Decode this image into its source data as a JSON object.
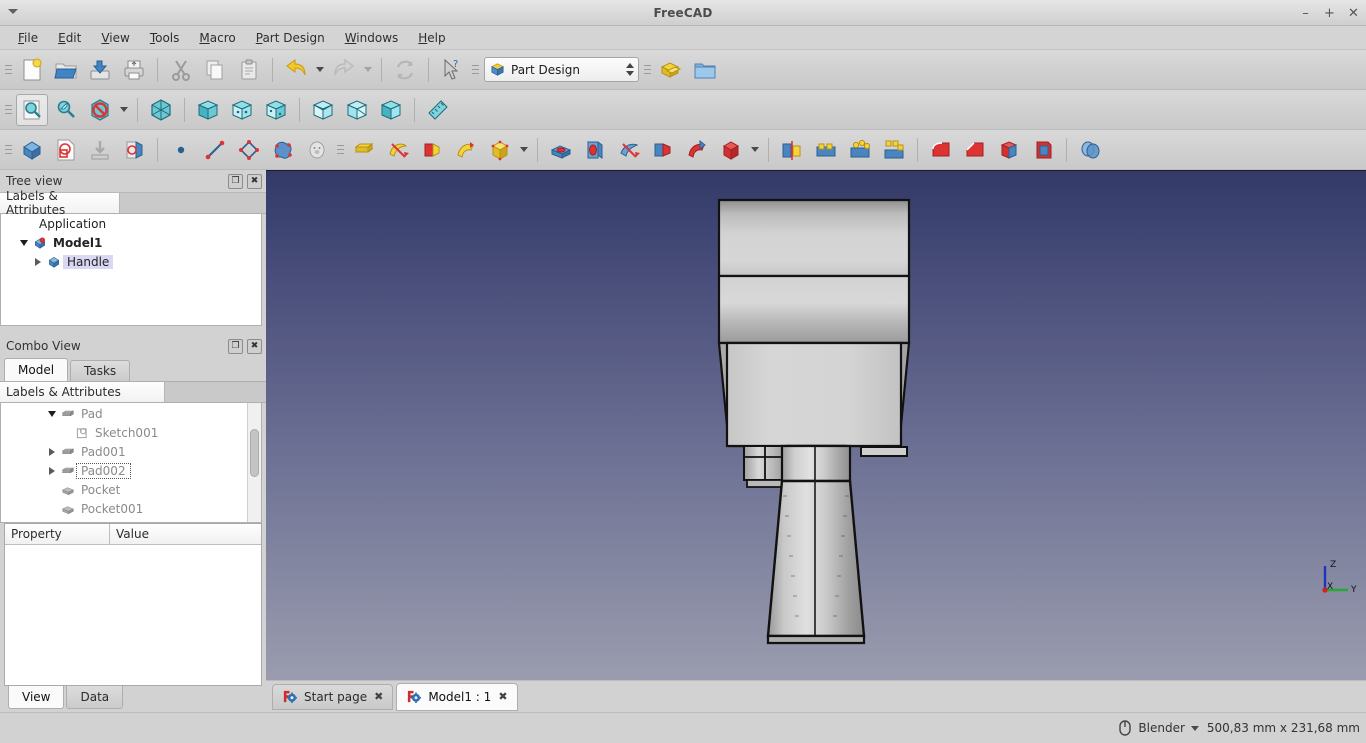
{
  "window": {
    "title": "FreeCAD",
    "minimize": "–",
    "maximize": "+",
    "close": "✕"
  },
  "menubar": {
    "items": [
      {
        "label": "File",
        "accel": "F"
      },
      {
        "label": "Edit",
        "accel": "E"
      },
      {
        "label": "View",
        "accel": "V"
      },
      {
        "label": "Tools",
        "accel": "T"
      },
      {
        "label": "Macro",
        "accel": "M"
      },
      {
        "label": "Part Design",
        "accel": "P"
      },
      {
        "label": "Windows",
        "accel": "W"
      },
      {
        "label": "Help",
        "accel": "H"
      }
    ]
  },
  "toolbars": {
    "file": {
      "icons": [
        "new-document-icon",
        "open-folder-icon",
        "save-icon",
        "print-icon",
        "cut-icon",
        "copy-icon",
        "paste-icon",
        "undo-icon",
        "redo-icon",
        "refresh-icon"
      ]
    },
    "workbench": {
      "whatsthis_icon": "whats-this-icon",
      "selected": "Part Design",
      "options": [
        "Part Design"
      ],
      "macro_icon": "macro-icon",
      "folder_icon": "folder-icon"
    },
    "view": {
      "icons": [
        "fit-all-icon",
        "zoom-box-icon",
        "draw-style-icon",
        "axonometric-icon",
        "front-view-icon",
        "top-view-icon",
        "right-view-icon",
        "rear-view-icon",
        "bottom-view-icon",
        "left-view-icon",
        "measure-icon"
      ]
    },
    "partdesign": {
      "icons": [
        "create-body-icon",
        "create-sketch-icon",
        "attachment-icon",
        "edit-sketch-icon",
        "point-icon",
        "line-icon",
        "datum-plane-icon",
        "shape-binder-icon",
        "clone-icon",
        "pad-icon",
        "revolution-icon",
        "additive-loft-icon",
        "additive-pipe-icon",
        "additive-box-icon",
        "pocket-icon",
        "hole-icon",
        "groove-icon",
        "subtractive-loft-icon",
        "subtractive-pipe-icon",
        "subtractive-box-icon",
        "mirrored-icon",
        "linear-pattern-icon",
        "polar-pattern-icon",
        "multi-transform-icon",
        "fillet-icon",
        "chamfer-icon",
        "draft-icon",
        "thickness-icon",
        "boolean-icon"
      ]
    }
  },
  "tree_view": {
    "title": "Tree view",
    "float_button": "❐",
    "close_button": "✖",
    "column_header": "Labels & Attributes",
    "items": [
      {
        "label": "Application",
        "depth": 0,
        "twist": "none",
        "icon": "none",
        "style": "plain"
      },
      {
        "label": "Model1",
        "depth": 1,
        "twist": "open",
        "icon": "document-icon",
        "style": "bold"
      },
      {
        "label": "Handle",
        "depth": 2,
        "twist": "closed",
        "icon": "body-icon",
        "style": "selected"
      }
    ]
  },
  "combo_view": {
    "title": "Combo View",
    "float_button": "❐",
    "close_button": "✖",
    "tabs": [
      {
        "label": "Model",
        "active": true
      },
      {
        "label": "Tasks",
        "active": false
      }
    ],
    "column_header": "Labels & Attributes",
    "items": [
      {
        "label": "Pad",
        "depth": 3,
        "twist": "open",
        "icon": "pad-tree-icon",
        "style": "dim"
      },
      {
        "label": "Sketch001",
        "depth": 4,
        "twist": "none",
        "icon": "sketch-tree-icon",
        "style": "dim"
      },
      {
        "label": "Pad001",
        "depth": 3,
        "twist": "closed",
        "icon": "pad-tree-icon",
        "style": "dim"
      },
      {
        "label": "Pad002",
        "depth": 3,
        "twist": "closed",
        "icon": "pad-tree-icon",
        "style": "dim focused"
      },
      {
        "label": "Pocket",
        "depth": 3,
        "twist": "none",
        "icon": "pocket-tree-icon",
        "style": "dim"
      },
      {
        "label": "Pocket001",
        "depth": 3,
        "twist": "none",
        "icon": "pocket-tree-icon",
        "style": "dim"
      }
    ]
  },
  "property_panel": {
    "columns": [
      "Property",
      "Value"
    ],
    "rows": [],
    "tabs": [
      {
        "label": "View",
        "active": true
      },
      {
        "label": "Data",
        "active": false
      }
    ]
  },
  "view3d": {
    "background_top": "#333a68",
    "background_bottom": "#9a9cae",
    "model_name": "handle-model",
    "axis": {
      "x": "X",
      "y": "Y",
      "z": "Z",
      "x_color": "#cc2222",
      "y_color": "#22aa33",
      "z_color": "#2233bb"
    }
  },
  "document_tabs": [
    {
      "label": "Start page",
      "active": false,
      "close": "✖",
      "icon": "freecad-logo-icon"
    },
    {
      "label": "Model1 : 1",
      "active": true,
      "close": "✖",
      "icon": "freecad-logo-icon"
    }
  ],
  "statusbar": {
    "nav_icon": "mouse-icon",
    "nav_style": "Blender",
    "dimensions": "500,83 mm x 231,68 mm"
  }
}
